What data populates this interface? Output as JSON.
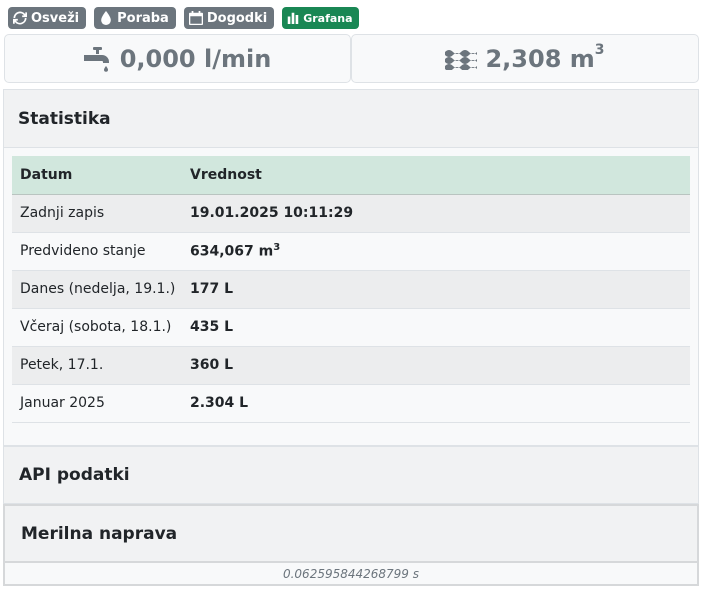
{
  "toolbar": {
    "refresh_label": "Osveži",
    "usage_label": "Poraba",
    "events_label": "Dogodki",
    "grafana_label": "Grafana"
  },
  "gauges": {
    "flow": {
      "value": "0,000 l/min",
      "icon": "faucet-icon"
    },
    "total": {
      "value": "2,308 m",
      "unit_sup": "3",
      "icon": "water-waves-icon"
    }
  },
  "stats": {
    "title": "Statistika",
    "columns": [
      "Datum",
      "Vrednost"
    ],
    "rows": [
      {
        "label": "Zadnji zapis",
        "value": "19.01.2025 10:11:29"
      },
      {
        "label": "Predvideno stanje",
        "value": "634,067 m",
        "value_sup": "3"
      },
      {
        "label": "Danes (nedelja, 19.1.)",
        "value": "177 L"
      },
      {
        "label": "Včeraj (sobota, 18.1.)",
        "value": "435 L"
      },
      {
        "label": "Petek, 17.1.",
        "value": "360 L"
      },
      {
        "label": "Januar 2025",
        "value": "2.304 L"
      }
    ]
  },
  "sections": {
    "api": "API podatki",
    "meter": "Merilna naprava"
  },
  "footer": {
    "timing": "0.062595844268799 s"
  },
  "colors": {
    "secondary": "#6c757d",
    "success": "#198754",
    "table_header": "#d1e7dd"
  }
}
